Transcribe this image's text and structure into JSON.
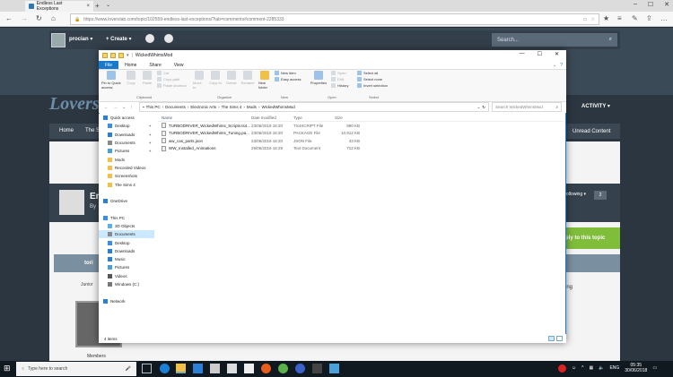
{
  "browser": {
    "tab_title": "Endless Last Exceptions",
    "url": "https://www.loverslab.com/topic/102559-endless-last-exceptions/?tab=comments#comment-2285333"
  },
  "site": {
    "username": "procian",
    "create_label": "Create",
    "search_placeholder": "Search...",
    "logo_text": "Lovers",
    "menu_home": "Home",
    "menu_thes": "The S",
    "activity": "ACTIVITY",
    "unread": "Unread Content",
    "topic_title": "En",
    "by": "By",
    "following": "Following",
    "follow_count": "2",
    "reply_label": "ply to this topic",
    "author": "tori",
    "rank": "Junior",
    "members": "Members",
    "post_text_fragment": "ing"
  },
  "explorer": {
    "window_title": "WickedWhimsMod",
    "menu": [
      "File",
      "Home",
      "Share",
      "View"
    ],
    "ribbon": {
      "pin": "Pin to Quick access",
      "copy": "Copy",
      "paste": "Paste",
      "cut": "Cut",
      "copy_path": "Copy path",
      "paste_shortcut": "Paste shortcut",
      "move_to": "Move to",
      "copy_to": "Copy to",
      "delete": "Delete",
      "rename": "Rename",
      "new_folder": "New folder",
      "new_item": "New item",
      "easy_access": "Easy access",
      "properties": "Properties",
      "open": "Open",
      "edit": "Edit",
      "history": "History",
      "select_all": "Select all",
      "select_none": "Select none",
      "invert_selection": "Invert selection",
      "group_clipboard": "Clipboard",
      "group_organize": "Organize",
      "group_new": "New",
      "group_open": "Open",
      "group_select": "Select"
    },
    "breadcrumb": [
      "This PC",
      "Documents",
      "Electronic Arts",
      "The Sims 4",
      "Mods",
      "WickedWhimsMod"
    ],
    "search_placeholder": "Search WickedWhimsMod",
    "nav": [
      {
        "label": "Quick access",
        "sub": false,
        "pin": false,
        "sel": false,
        "color": "#2b7fd4"
      },
      {
        "label": "Desktop",
        "sub": true,
        "pin": true,
        "sel": false,
        "color": "#3a8ee6"
      },
      {
        "label": "Downloads",
        "sub": true,
        "pin": true,
        "sel": false,
        "color": "#2b7fd4"
      },
      {
        "label": "Documents",
        "sub": true,
        "pin": true,
        "sel": false,
        "color": "#8a8a8a"
      },
      {
        "label": "Pictures",
        "sub": true,
        "pin": true,
        "sel": false,
        "color": "#4aa0d8"
      },
      {
        "label": "Mods",
        "sub": true,
        "pin": false,
        "sel": false,
        "color": "#f0c048"
      },
      {
        "label": "Recorded Videos",
        "sub": true,
        "pin": false,
        "sel": false,
        "color": "#f0c048"
      },
      {
        "label": "Screenshots",
        "sub": true,
        "pin": false,
        "sel": false,
        "color": "#f0c048"
      },
      {
        "label": "The Sims 4",
        "sub": true,
        "pin": false,
        "sel": false,
        "color": "#f0c048"
      },
      {
        "label": "",
        "sub": false,
        "pin": false,
        "sel": false,
        "color": ""
      },
      {
        "label": "OneDrive",
        "sub": false,
        "pin": false,
        "sel": false,
        "color": "#2b7fd4"
      },
      {
        "label": "",
        "sub": false,
        "pin": false,
        "sel": false,
        "color": ""
      },
      {
        "label": "This PC",
        "sub": false,
        "pin": false,
        "sel": false,
        "color": "#3a8ee6"
      },
      {
        "label": "3D Objects",
        "sub": true,
        "pin": false,
        "sel": false,
        "color": "#5ab0e8"
      },
      {
        "label": "Documents",
        "sub": true,
        "pin": false,
        "sel": true,
        "color": "#8a8a8a"
      },
      {
        "label": "Desktop",
        "sub": true,
        "pin": false,
        "sel": false,
        "color": "#3a8ee6"
      },
      {
        "label": "Downloads",
        "sub": true,
        "pin": false,
        "sel": false,
        "color": "#2b7fd4"
      },
      {
        "label": "Music",
        "sub": true,
        "pin": false,
        "sel": false,
        "color": "#2b7fd4"
      },
      {
        "label": "Pictures",
        "sub": true,
        "pin": false,
        "sel": false,
        "color": "#4aa0d8"
      },
      {
        "label": "Videos",
        "sub": true,
        "pin": false,
        "sel": false,
        "color": "#555555"
      },
      {
        "label": "Windows (C:)",
        "sub": true,
        "pin": false,
        "sel": false,
        "color": "#777777"
      },
      {
        "label": "",
        "sub": false,
        "pin": false,
        "sel": false,
        "color": ""
      },
      {
        "label": "Network",
        "sub": false,
        "pin": false,
        "sel": false,
        "color": "#2b7fd4"
      }
    ],
    "columns": [
      "Name",
      "Date modified",
      "Type",
      "Size"
    ],
    "files": [
      {
        "name": "TURBODRIVER_WickedWhims_Scripts.ts4...",
        "date": "23/06/2018 16:20",
        "type": "TS4SCRIPT File",
        "size": "890 KB"
      },
      {
        "name": "TURBODRIVER_WickedWhims_Tuning.pa...",
        "date": "23/06/2018 16:20",
        "type": "PACKAGE File",
        "size": "10,912 KB"
      },
      {
        "name": "ww_cas_parts.json",
        "date": "23/06/2018 16:20",
        "type": "JSON File",
        "size": "43 KB"
      },
      {
        "name": "WW_Installed_Animations",
        "date": "29/06/2018 16:29",
        "type": "Text Document",
        "size": "712 KB"
      }
    ],
    "status": "4 items"
  },
  "taskbar": {
    "search_placeholder": "Type here to search",
    "lang": "ENG",
    "time": "05:35",
    "date": "30/06/2018"
  }
}
